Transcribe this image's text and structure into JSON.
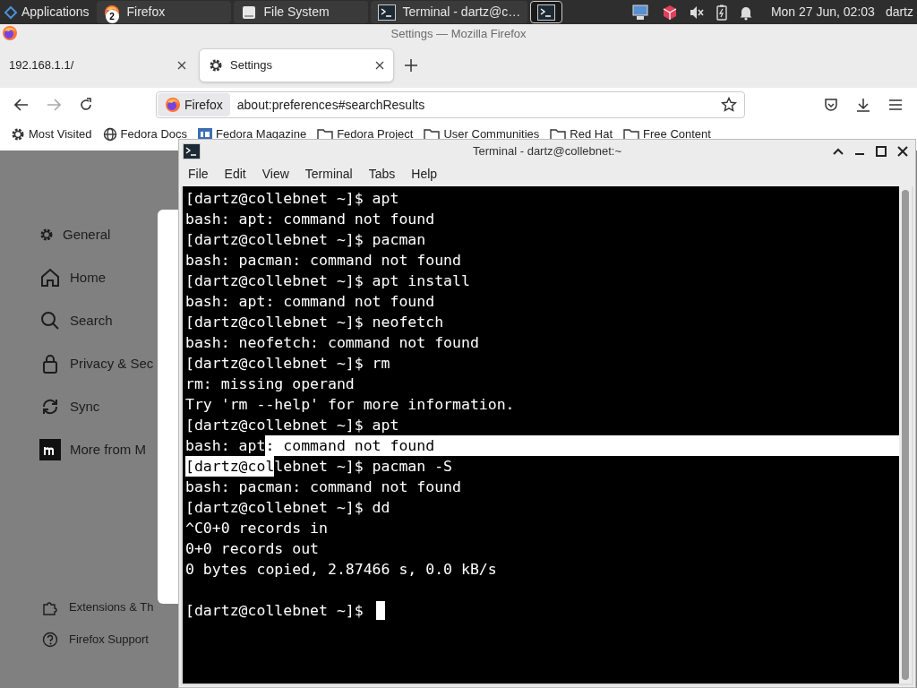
{
  "taskbar": {
    "apps_label": "Applications",
    "tasks": [
      {
        "kind": "firefox",
        "label": "Firefox",
        "badge": "2",
        "selected": false
      },
      {
        "kind": "files",
        "label": "File System",
        "selected": false
      },
      {
        "kind": "terminal",
        "label": "Terminal - dartz@c…",
        "selected": false
      },
      {
        "kind": "terminal",
        "selected": true
      }
    ],
    "clock": "Mon 27 Jun, 02:03",
    "user": "dartz"
  },
  "firefox": {
    "title": "Settings — Mozilla Firefox",
    "tabs": [
      {
        "label": "192.168.1.1/",
        "kind": "page",
        "selected": false
      },
      {
        "label": "Settings",
        "kind": "gear",
        "selected": true
      }
    ],
    "identity": "Firefox",
    "url": "about:preferences#searchResults",
    "bookmarks": [
      {
        "kind": "gear",
        "label": "Most Visited"
      },
      {
        "kind": "globe",
        "label": "Fedora Docs"
      },
      {
        "kind": "fm",
        "label": "Fedora Magazine"
      },
      {
        "kind": "folder",
        "label": "Fedora Project"
      },
      {
        "kind": "folder",
        "label": "User Communities"
      },
      {
        "kind": "folder",
        "label": "Red Hat"
      },
      {
        "kind": "folder",
        "label": "Free Content"
      }
    ],
    "sidebar": [
      {
        "kind": "gear",
        "label": "General"
      },
      {
        "kind": "home",
        "label": "Home"
      },
      {
        "kind": "search",
        "label": "Search"
      },
      {
        "kind": "lock",
        "label": "Privacy & Sec"
      },
      {
        "kind": "sync",
        "label": "Sync"
      },
      {
        "kind": "m",
        "label": "More from M"
      }
    ],
    "footer": [
      {
        "kind": "puzzle",
        "label": "Extensions & Th"
      },
      {
        "kind": "help",
        "label": "Firefox Support"
      }
    ]
  },
  "terminal": {
    "title": "Terminal - dartz@collebnet:~",
    "menu": [
      "File",
      "Edit",
      "View",
      "Terminal",
      "Tabs",
      "Help"
    ],
    "lines": [
      {
        "segments": [
          {
            "text": "[dartz@collebnet ~]$ apt",
            "selected": false
          }
        ]
      },
      {
        "segments": [
          {
            "text": "bash: apt: command not found",
            "selected": false
          }
        ]
      },
      {
        "segments": [
          {
            "text": "[dartz@collebnet ~]$ pacman",
            "selected": false
          }
        ]
      },
      {
        "segments": [
          {
            "text": "bash: pacman: command not found",
            "selected": false
          }
        ]
      },
      {
        "segments": [
          {
            "text": "[dartz@collebnet ~]$ apt install",
            "selected": false
          }
        ]
      },
      {
        "segments": [
          {
            "text": "bash: apt: command not found",
            "selected": false
          }
        ]
      },
      {
        "segments": [
          {
            "text": "[dartz@collebnet ~]$ neofetch",
            "selected": false
          }
        ]
      },
      {
        "segments": [
          {
            "text": "bash: neofetch: command not found",
            "selected": false
          }
        ]
      },
      {
        "segments": [
          {
            "text": "[dartz@collebnet ~]$ rm",
            "selected": false
          }
        ]
      },
      {
        "segments": [
          {
            "text": "rm: missing operand",
            "selected": false
          }
        ]
      },
      {
        "segments": [
          {
            "text": "Try 'rm --help' for more information.",
            "selected": false
          }
        ]
      },
      {
        "segments": [
          {
            "text": "[dartz@collebnet ~]$ apt",
            "selected": false
          }
        ]
      },
      {
        "segments": [
          {
            "text": "bash: apt",
            "selected": false
          },
          {
            "text": ": command not found",
            "selected": true
          }
        ]
      },
      {
        "segments": [
          {
            "text": "[dartz@col",
            "selected": true
          },
          {
            "text": "lebnet ~]$ pacman -S",
            "selected": false
          }
        ]
      },
      {
        "segments": [
          {
            "text": "bash: pacman: command not found",
            "selected": false
          }
        ]
      },
      {
        "segments": [
          {
            "text": "[dartz@collebnet ~]$ dd",
            "selected": false
          }
        ]
      },
      {
        "segments": [
          {
            "text": "^C0+0 records in",
            "selected": false
          }
        ]
      },
      {
        "segments": [
          {
            "text": "0+0 records out",
            "selected": false
          }
        ]
      },
      {
        "segments": [
          {
            "text": "0 bytes copied, 2.87466 s, 0.0 kB/s",
            "selected": false
          }
        ]
      },
      {
        "cursor": false
      },
      {
        "segments": [
          {
            "text": "[dartz@collebnet ~]$",
            "selected": false
          }
        ],
        "cursor": true
      }
    ]
  }
}
